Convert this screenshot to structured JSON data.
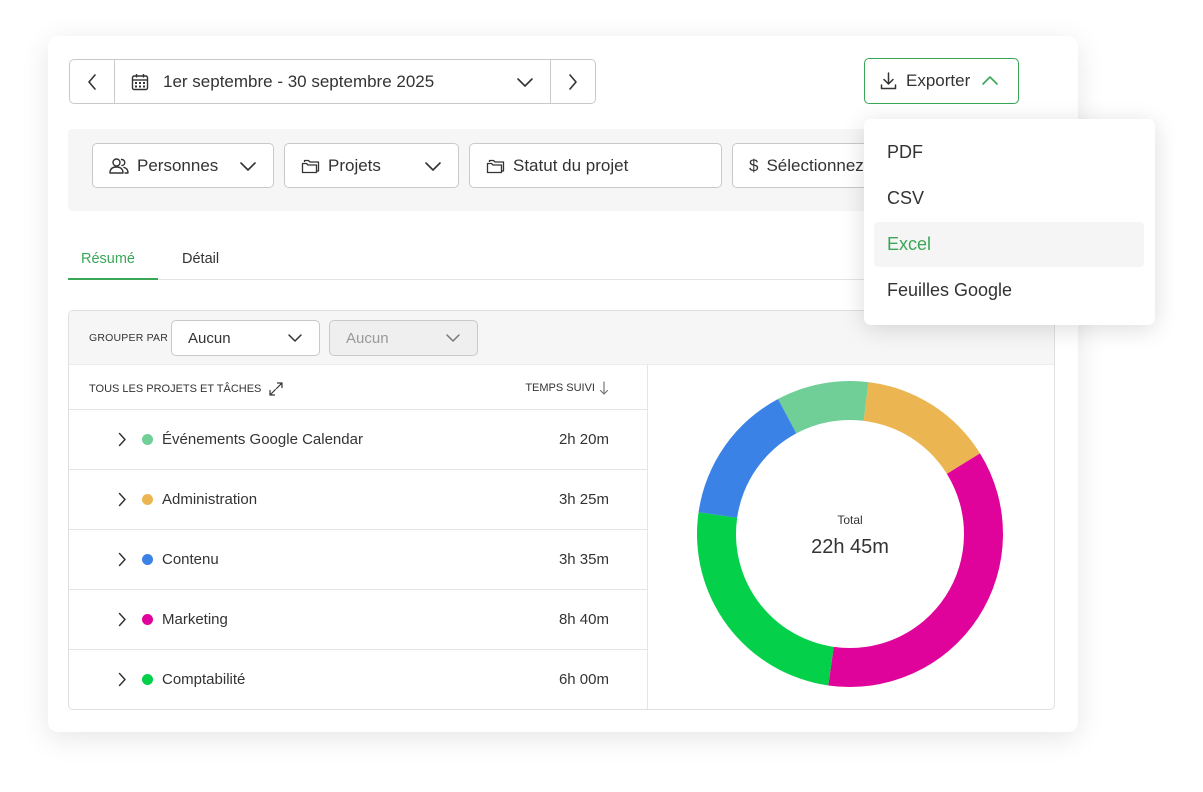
{
  "date_range": {
    "label": "1er septembre - 30 septembre 2025"
  },
  "export": {
    "label": "Exporter"
  },
  "filters": [
    {
      "label": "Personnes"
    },
    {
      "label": "Projets"
    },
    {
      "label": "Statut du projet"
    },
    {
      "label": "Sélectionnez"
    }
  ],
  "tabs": [
    {
      "label": "Résumé"
    },
    {
      "label": "Détail"
    }
  ],
  "group_by": {
    "label": "GROUPER PAR",
    "first": "Aucun",
    "second": "Aucun"
  },
  "table": {
    "col_projects": "TOUS LES PROJETS ET TÂCHES",
    "col_time": "TEMPS SUIVI",
    "rows": [
      {
        "name": "Événements Google Calendar",
        "time": "2h 20m",
        "color": "#6fcf97"
      },
      {
        "name": "Administration",
        "time": "3h 25m",
        "color": "#ebb551"
      },
      {
        "name": "Contenu",
        "time": "3h 35m",
        "color": "#3b82e6"
      },
      {
        "name": "Marketing",
        "time": "8h 40m",
        "color": "#e0039b"
      },
      {
        "name": "Comptabilité",
        "time": "6h 00m",
        "color": "#05d04a"
      }
    ]
  },
  "chart_data": {
    "type": "pie",
    "donut": true,
    "center_label": "Total",
    "center_value": "22h 45m",
    "slices": [
      {
        "label": "Événements Google Calendar",
        "value": 140,
        "color": "#6fcf97"
      },
      {
        "label": "Administration",
        "value": 205,
        "color": "#ebb551"
      },
      {
        "label": "Marketing",
        "value": 520,
        "color": "#e0039b"
      },
      {
        "label": "Comptabilité",
        "value": 360,
        "color": "#05d04a"
      },
      {
        "label": "Contenu",
        "value": 215,
        "color": "#3b82e6"
      }
    ]
  },
  "dropdown": {
    "items": [
      {
        "label": "PDF",
        "highlighted": false
      },
      {
        "label": "CSV",
        "highlighted": false
      },
      {
        "label": "Excel",
        "highlighted": true
      },
      {
        "label": "Feuilles Google",
        "highlighted": false
      }
    ]
  }
}
